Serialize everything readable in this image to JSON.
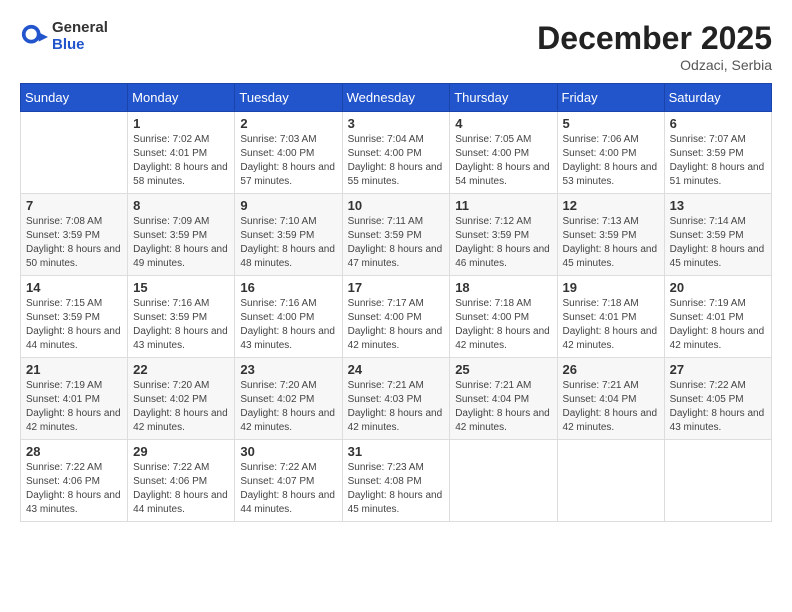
{
  "logo": {
    "general": "General",
    "blue": "Blue"
  },
  "header": {
    "month_year": "December 2025",
    "location": "Odzaci, Serbia"
  },
  "weekdays": [
    "Sunday",
    "Monday",
    "Tuesday",
    "Wednesday",
    "Thursday",
    "Friday",
    "Saturday"
  ],
  "weeks": [
    [
      {
        "day": "",
        "sunrise": "",
        "sunset": "",
        "daylight": ""
      },
      {
        "day": "1",
        "sunrise": "Sunrise: 7:02 AM",
        "sunset": "Sunset: 4:01 PM",
        "daylight": "Daylight: 8 hours and 58 minutes."
      },
      {
        "day": "2",
        "sunrise": "Sunrise: 7:03 AM",
        "sunset": "Sunset: 4:00 PM",
        "daylight": "Daylight: 8 hours and 57 minutes."
      },
      {
        "day": "3",
        "sunrise": "Sunrise: 7:04 AM",
        "sunset": "Sunset: 4:00 PM",
        "daylight": "Daylight: 8 hours and 55 minutes."
      },
      {
        "day": "4",
        "sunrise": "Sunrise: 7:05 AM",
        "sunset": "Sunset: 4:00 PM",
        "daylight": "Daylight: 8 hours and 54 minutes."
      },
      {
        "day": "5",
        "sunrise": "Sunrise: 7:06 AM",
        "sunset": "Sunset: 4:00 PM",
        "daylight": "Daylight: 8 hours and 53 minutes."
      },
      {
        "day": "6",
        "sunrise": "Sunrise: 7:07 AM",
        "sunset": "Sunset: 3:59 PM",
        "daylight": "Daylight: 8 hours and 51 minutes."
      }
    ],
    [
      {
        "day": "7",
        "sunrise": "Sunrise: 7:08 AM",
        "sunset": "Sunset: 3:59 PM",
        "daylight": "Daylight: 8 hours and 50 minutes."
      },
      {
        "day": "8",
        "sunrise": "Sunrise: 7:09 AM",
        "sunset": "Sunset: 3:59 PM",
        "daylight": "Daylight: 8 hours and 49 minutes."
      },
      {
        "day": "9",
        "sunrise": "Sunrise: 7:10 AM",
        "sunset": "Sunset: 3:59 PM",
        "daylight": "Daylight: 8 hours and 48 minutes."
      },
      {
        "day": "10",
        "sunrise": "Sunrise: 7:11 AM",
        "sunset": "Sunset: 3:59 PM",
        "daylight": "Daylight: 8 hours and 47 minutes."
      },
      {
        "day": "11",
        "sunrise": "Sunrise: 7:12 AM",
        "sunset": "Sunset: 3:59 PM",
        "daylight": "Daylight: 8 hours and 46 minutes."
      },
      {
        "day": "12",
        "sunrise": "Sunrise: 7:13 AM",
        "sunset": "Sunset: 3:59 PM",
        "daylight": "Daylight: 8 hours and 45 minutes."
      },
      {
        "day": "13",
        "sunrise": "Sunrise: 7:14 AM",
        "sunset": "Sunset: 3:59 PM",
        "daylight": "Daylight: 8 hours and 45 minutes."
      }
    ],
    [
      {
        "day": "14",
        "sunrise": "Sunrise: 7:15 AM",
        "sunset": "Sunset: 3:59 PM",
        "daylight": "Daylight: 8 hours and 44 minutes."
      },
      {
        "day": "15",
        "sunrise": "Sunrise: 7:16 AM",
        "sunset": "Sunset: 3:59 PM",
        "daylight": "Daylight: 8 hours and 43 minutes."
      },
      {
        "day": "16",
        "sunrise": "Sunrise: 7:16 AM",
        "sunset": "Sunset: 4:00 PM",
        "daylight": "Daylight: 8 hours and 43 minutes."
      },
      {
        "day": "17",
        "sunrise": "Sunrise: 7:17 AM",
        "sunset": "Sunset: 4:00 PM",
        "daylight": "Daylight: 8 hours and 42 minutes."
      },
      {
        "day": "18",
        "sunrise": "Sunrise: 7:18 AM",
        "sunset": "Sunset: 4:00 PM",
        "daylight": "Daylight: 8 hours and 42 minutes."
      },
      {
        "day": "19",
        "sunrise": "Sunrise: 7:18 AM",
        "sunset": "Sunset: 4:01 PM",
        "daylight": "Daylight: 8 hours and 42 minutes."
      },
      {
        "day": "20",
        "sunrise": "Sunrise: 7:19 AM",
        "sunset": "Sunset: 4:01 PM",
        "daylight": "Daylight: 8 hours and 42 minutes."
      }
    ],
    [
      {
        "day": "21",
        "sunrise": "Sunrise: 7:19 AM",
        "sunset": "Sunset: 4:01 PM",
        "daylight": "Daylight: 8 hours and 42 minutes."
      },
      {
        "day": "22",
        "sunrise": "Sunrise: 7:20 AM",
        "sunset": "Sunset: 4:02 PM",
        "daylight": "Daylight: 8 hours and 42 minutes."
      },
      {
        "day": "23",
        "sunrise": "Sunrise: 7:20 AM",
        "sunset": "Sunset: 4:02 PM",
        "daylight": "Daylight: 8 hours and 42 minutes."
      },
      {
        "day": "24",
        "sunrise": "Sunrise: 7:21 AM",
        "sunset": "Sunset: 4:03 PM",
        "daylight": "Daylight: 8 hours and 42 minutes."
      },
      {
        "day": "25",
        "sunrise": "Sunrise: 7:21 AM",
        "sunset": "Sunset: 4:04 PM",
        "daylight": "Daylight: 8 hours and 42 minutes."
      },
      {
        "day": "26",
        "sunrise": "Sunrise: 7:21 AM",
        "sunset": "Sunset: 4:04 PM",
        "daylight": "Daylight: 8 hours and 42 minutes."
      },
      {
        "day": "27",
        "sunrise": "Sunrise: 7:22 AM",
        "sunset": "Sunset: 4:05 PM",
        "daylight": "Daylight: 8 hours and 43 minutes."
      }
    ],
    [
      {
        "day": "28",
        "sunrise": "Sunrise: 7:22 AM",
        "sunset": "Sunset: 4:06 PM",
        "daylight": "Daylight: 8 hours and 43 minutes."
      },
      {
        "day": "29",
        "sunrise": "Sunrise: 7:22 AM",
        "sunset": "Sunset: 4:06 PM",
        "daylight": "Daylight: 8 hours and 44 minutes."
      },
      {
        "day": "30",
        "sunrise": "Sunrise: 7:22 AM",
        "sunset": "Sunset: 4:07 PM",
        "daylight": "Daylight: 8 hours and 44 minutes."
      },
      {
        "day": "31",
        "sunrise": "Sunrise: 7:23 AM",
        "sunset": "Sunset: 4:08 PM",
        "daylight": "Daylight: 8 hours and 45 minutes."
      },
      {
        "day": "",
        "sunrise": "",
        "sunset": "",
        "daylight": ""
      },
      {
        "day": "",
        "sunrise": "",
        "sunset": "",
        "daylight": ""
      },
      {
        "day": "",
        "sunrise": "",
        "sunset": "",
        "daylight": ""
      }
    ]
  ]
}
